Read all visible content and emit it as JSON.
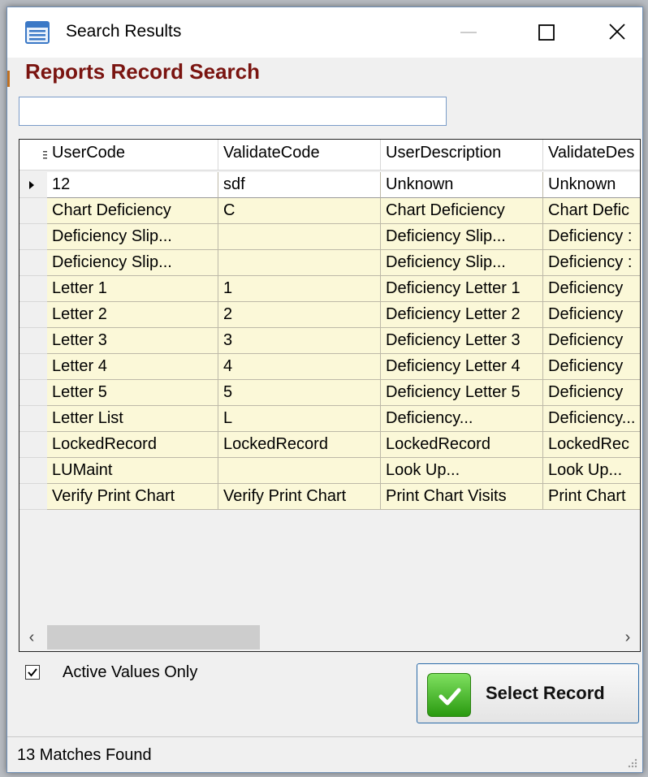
{
  "window": {
    "title": "Search Results",
    "heading": "Reports Record Search"
  },
  "search": {
    "value": "",
    "placeholder": ""
  },
  "grid": {
    "columns": [
      "UserCode",
      "ValidateCode",
      "UserDescription",
      "ValidateDes"
    ],
    "selected_row": 0,
    "rows": [
      [
        "12",
        "sdf",
        "Unknown",
        "Unknown"
      ],
      [
        "Chart Deficiency",
        "C",
        "Chart Deficiency",
        "Chart Defic"
      ],
      [
        "Deficiency Slip...",
        "",
        "Deficiency Slip...",
        "Deficiency :"
      ],
      [
        "Deficiency Slip...",
        "",
        "Deficiency Slip...",
        "Deficiency :"
      ],
      [
        "Letter 1",
        "1",
        "Deficiency Letter 1",
        "Deficiency"
      ],
      [
        "Letter 2",
        "2",
        "Deficiency Letter 2",
        "Deficiency"
      ],
      [
        "Letter 3",
        "3",
        "Deficiency Letter 3",
        "Deficiency"
      ],
      [
        "Letter 4",
        "4",
        "Deficiency Letter 4",
        "Deficiency"
      ],
      [
        "Letter 5",
        "5",
        "Deficiency Letter 5",
        "Deficiency"
      ],
      [
        "Letter List",
        "L",
        "Deficiency...",
        "Deficiency..."
      ],
      [
        "LockedRecord",
        "LockedRecord",
        "LockedRecord",
        "LockedRec"
      ],
      [
        "LUMaint",
        "",
        "Look Up...",
        "Look Up..."
      ],
      [
        "Verify Print Chart",
        "Verify Print Chart",
        "Print Chart Visits",
        "Print Chart"
      ]
    ]
  },
  "options": {
    "active_values_label": "Active Values Only",
    "active_values_checked": true
  },
  "actions": {
    "select_record_label": "Select Record"
  },
  "status": {
    "text": "13 Matches Found"
  },
  "colors": {
    "row_background": "#fbf8d8",
    "heading": "#7a1410",
    "button_border": "#2a6aa8"
  },
  "icons": [
    "app-window-icon",
    "minimize-icon",
    "maximize-icon",
    "close-icon",
    "column-chooser-icon",
    "row-selector-arrow-icon",
    "scroll-left-icon",
    "scroll-right-icon",
    "checkmark-icon",
    "resize-grip-icon"
  ]
}
